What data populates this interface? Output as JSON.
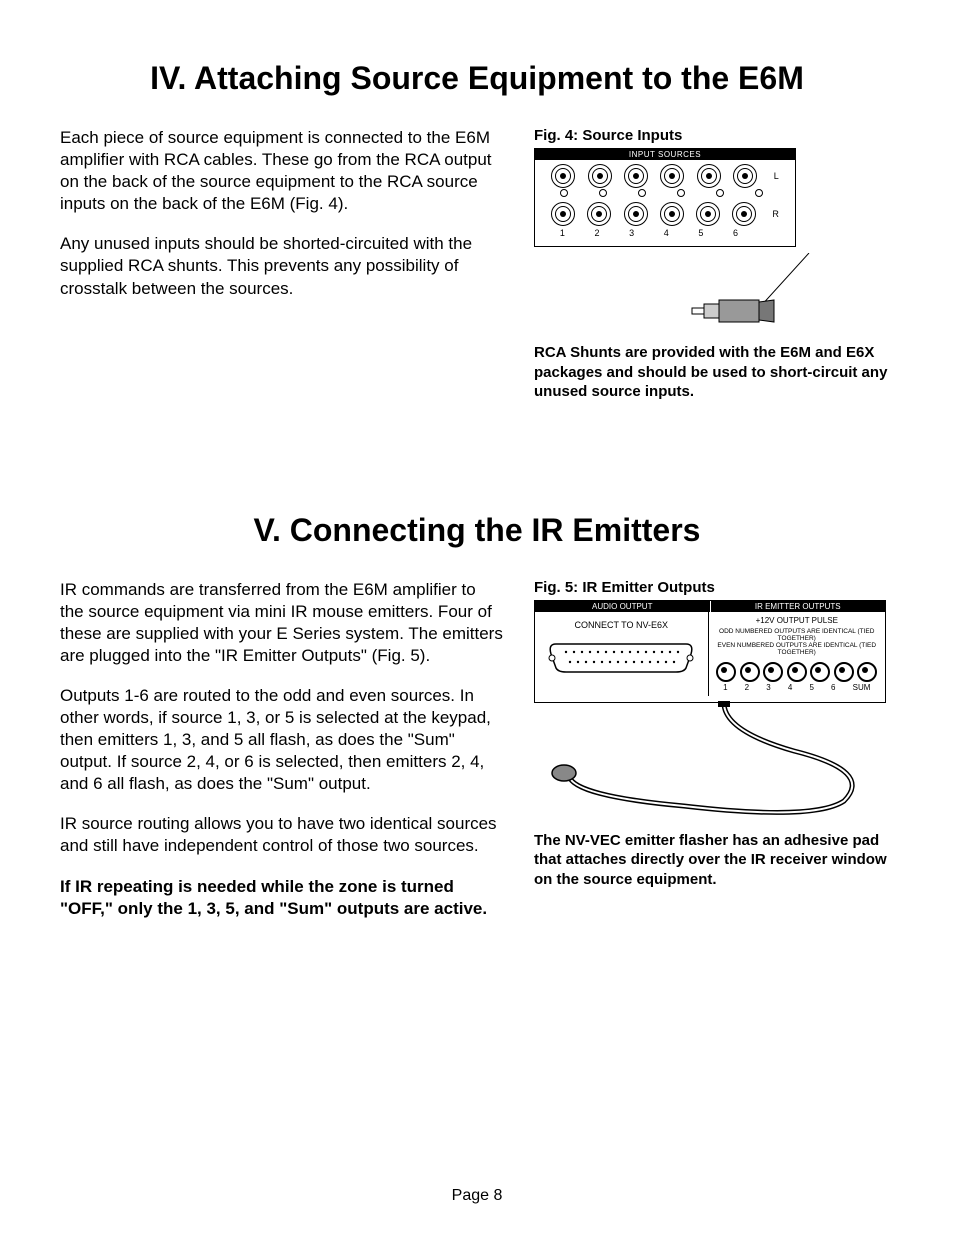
{
  "section4": {
    "heading": "IV. Attaching Source Equipment to the E6M",
    "p1": "Each piece of source equipment is connected to the E6M amplifier with RCA cables. These go from the RCA output on the back of the source equipment to the RCA source inputs on the back of the E6M (Fig. 4).",
    "p2": "Any unused inputs should  be shorted-circuited with the supplied RCA shunts. This prevents any possibility of crosstalk between the sources.",
    "fig_caption": "Fig. 4: Source Inputs",
    "panel_label": "INPUT SOURCES",
    "lr": {
      "l": "L",
      "r": "R"
    },
    "nums": [
      "1",
      "2",
      "3",
      "4",
      "5",
      "6"
    ],
    "note": "RCA Shunts are provided with the E6M and E6X packages and should be used to short-circuit any unused source inputs."
  },
  "section5": {
    "heading": "V. Connecting the IR Emitters",
    "p1": "IR commands are transferred from the E6M amplifier to the source equipment via mini IR mouse emitters. Four of these are supplied with your E Series system. The emitters are plugged into the \"IR Emitter Outputs\" (Fig. 5).",
    "p2": "Outputs 1-6 are routed to the odd and even sources. In other words, if source 1, 3, or 5 is selected at the keypad, then emitters 1, 3, and 5 all flash, as does the \"Sum\" output. If source 2, 4, or 6 is selected, then emitters 2, 4, and 6 all flash, as does the \"Sum\" output.",
    "p3": "IR source routing allows you to have two identical sources and still have independent control of those two sources.",
    "p4": "If IR repeating is needed while the zone is turned \"OFF,\" only the 1, 3, 5, and \"Sum\" outputs are active.",
    "fig_caption": "Fig. 5: IR Emitter Outputs",
    "hdr_left": "AUDIO OUTPUT",
    "hdr_right": "IR EMITTER OUTPUTS",
    "connect": "CONNECT TO NV-E6X",
    "pulse": "+12V OUTPUT PULSE",
    "tied1": "ODD NUMBERED OUTPUTS ARE IDENTICAL (TIED TOGETHER)",
    "tied2": "EVEN NUMBERED OUTPUTS ARE IDENTICAL (TIED TOGETHER)",
    "ir_nums": [
      "1",
      "2",
      "3",
      "4",
      "5",
      "6",
      "SUM"
    ],
    "note": "The NV-VEC emitter flasher has an adhesive pad that attaches directly over the IR receiver window on the source equipment."
  },
  "page": "Page 8"
}
